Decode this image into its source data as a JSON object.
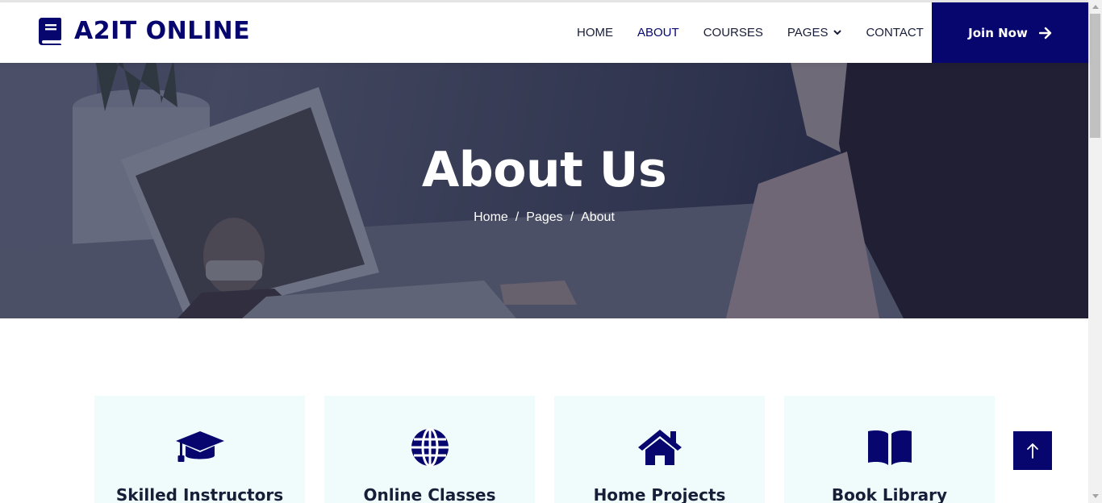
{
  "brand": {
    "name": "A2IT ONLINE",
    "icon": "book-icon",
    "color": "#06066e"
  },
  "nav": {
    "items": [
      {
        "label": "HOME",
        "active": false
      },
      {
        "label": "ABOUT",
        "active": true
      },
      {
        "label": "COURSES",
        "active": false
      },
      {
        "label": "PAGES",
        "active": false,
        "dropdown": true
      },
      {
        "label": "CONTACT",
        "active": false
      }
    ],
    "join_label": "Join Now",
    "join_icon": "arrow-right-icon"
  },
  "hero": {
    "title": "About Us",
    "breadcrumb": [
      "Home",
      "Pages",
      "About"
    ],
    "separator": "/"
  },
  "features": [
    {
      "title": "Skilled Instructors",
      "icon": "graduation-cap-icon"
    },
    {
      "title": "Online Classes",
      "icon": "globe-icon"
    },
    {
      "title": "Home Projects",
      "icon": "home-icon"
    },
    {
      "title": "Book Library",
      "icon": "book-open-icon"
    }
  ],
  "back_to_top": {
    "icon": "arrow-up-icon"
  },
  "colors": {
    "primary": "#06066e",
    "feature_bg": "#f0fbfc",
    "text_dark": "#181d38"
  }
}
